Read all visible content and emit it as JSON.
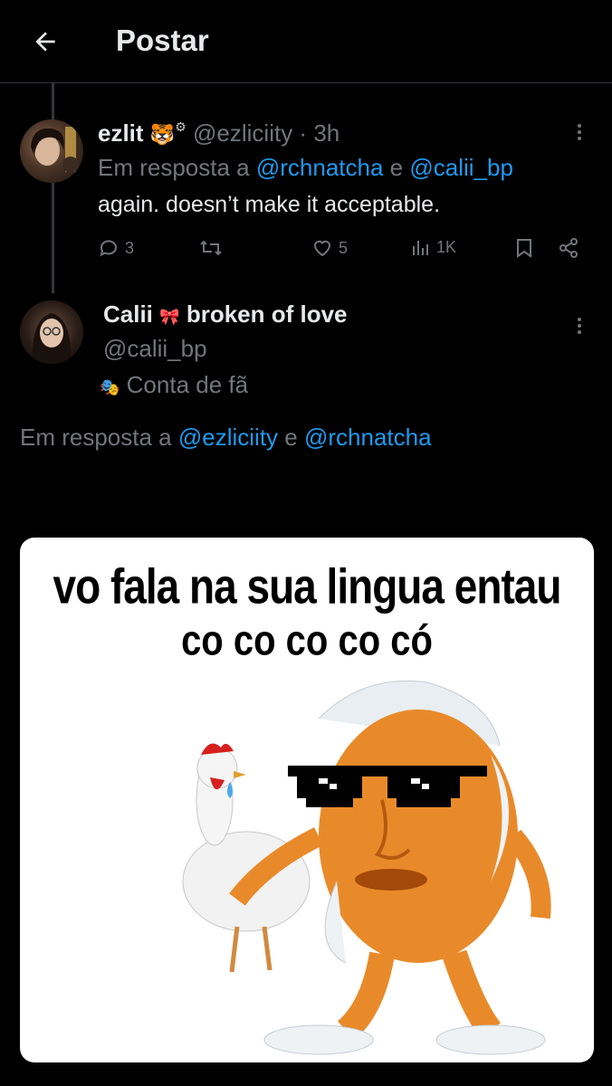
{
  "header": {
    "title": "Postar"
  },
  "tweet1": {
    "name": "ezlit",
    "handle": "@ezliciity",
    "sep": " · ",
    "time": "3h",
    "reply_prefix": "Em resposta a ",
    "reply_user1": "@rchnatcha",
    "reply_and": " e ",
    "reply_user2": "@calii_bp",
    "text": "again. doesn’t make it acceptable.",
    "replies": "3",
    "likes": "5",
    "views": "1K"
  },
  "tweet2": {
    "name": "Calii",
    "name_symbol": "🎀",
    "name_rest": "broken of love",
    "handle": "@calii_bp",
    "badge_icon": "🎭",
    "badge": "Conta de fã",
    "reply_prefix": "Em resposta a ",
    "reply_user1": "@ezliciity",
    "reply_and": " e ",
    "reply_user2": "@rchnatcha"
  },
  "meme": {
    "line1": "vo fala na sua lingua entau",
    "line2": "co co co co có"
  },
  "colors": {
    "background": "#000000",
    "text": "#e7e9ea",
    "muted": "#71767b",
    "link": "#1d9bf0",
    "divider": "#2f3336"
  }
}
